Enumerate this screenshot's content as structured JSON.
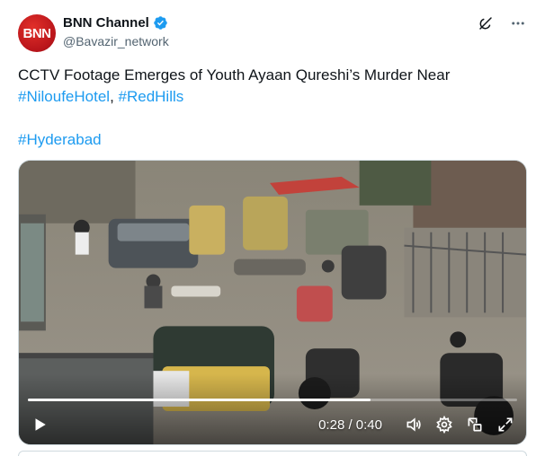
{
  "author": {
    "avatar_text": "BNN",
    "display_name": "BNN Channel",
    "handle": "@Bavazir_network",
    "verified": true
  },
  "actions": {
    "grok_icon": "grok-icon",
    "more_icon": "more-icon"
  },
  "tweet": {
    "line1": "CCTV Footage Emerges of Youth Ayaan Qureshi’s Murder Near",
    "hashtag1": "#NiloufeHotel",
    "separator": ", ",
    "hashtag2": "#RedHills",
    "hashtag3": "#Hyderabad"
  },
  "video": {
    "time_display": "0:28 / 0:40",
    "progress": 0.7
  },
  "colors": {
    "accent": "#1d9bf0",
    "text": "#0f1419",
    "muted": "#536471"
  }
}
